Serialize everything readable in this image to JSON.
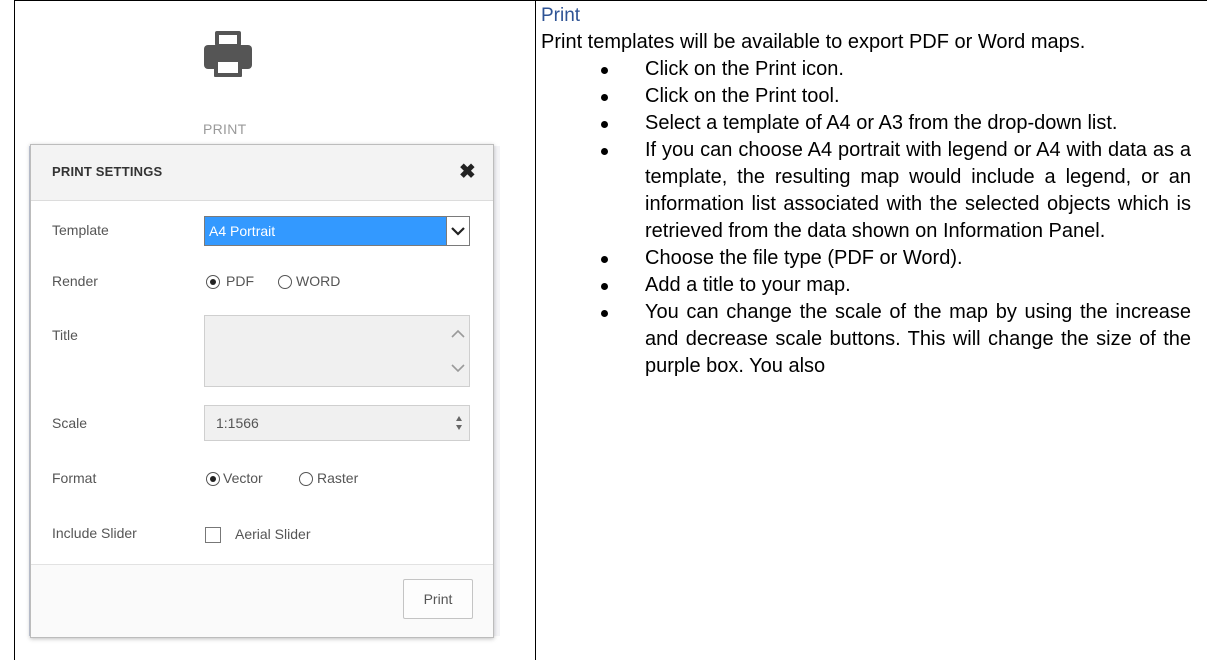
{
  "left_panel": {
    "print_caption": "PRINT",
    "dialog": {
      "title": "PRINT SETTINGS",
      "close_glyph": "✖",
      "fields": {
        "template_label": "Template",
        "template_value": "A4 Portrait",
        "render_label": "Render",
        "render_options": [
          "PDF",
          "WORD"
        ],
        "render_selected": "PDF",
        "title_label": "Title",
        "title_value": "",
        "scale_label": "Scale",
        "scale_value": "1:1566",
        "format_label": "Format",
        "format_options": [
          "Vector",
          "Raster"
        ],
        "format_selected": "Vector",
        "include_slider_label": "Include Slider",
        "aerial_slider_label": "Aerial Slider",
        "aerial_slider_checked": false
      },
      "print_button": "Print"
    }
  },
  "right_panel": {
    "heading": "Print",
    "intro": "Print templates will be available to export PDF or Word maps.",
    "bullets": [
      "Click on the Print icon.",
      "Click on the Print tool.",
      "Select a template of A4 or A3 from the drop-down list.",
      "If you can choose A4 portrait with legend or A4 with data as a template, the resulting map would include a legend, or an information list associated with the selected objects which is retrieved from the data shown on Information Panel.",
      "Choose the file type (PDF or Word).",
      "Add a title to your map.",
      "You can change the scale of the map by using the increase and decrease scale buttons. This will change the size of the purple box. You also"
    ]
  },
  "colors": {
    "heading": "#2e5395",
    "selection": "#3399ff"
  }
}
